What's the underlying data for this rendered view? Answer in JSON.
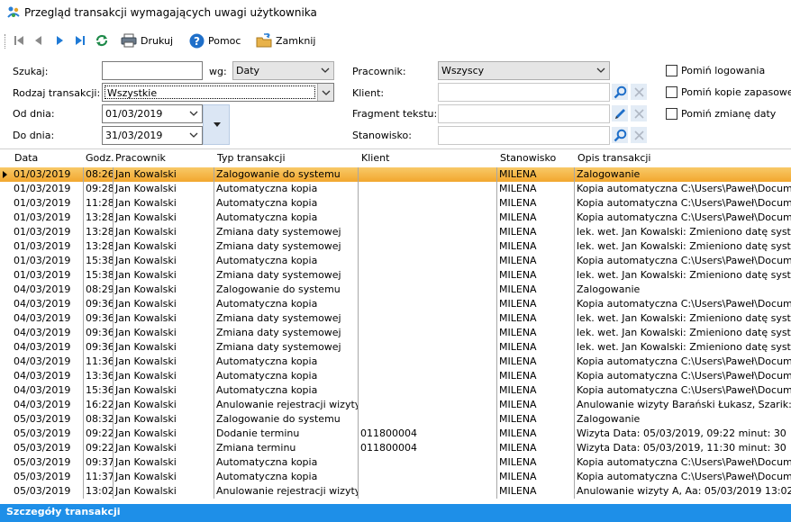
{
  "window": {
    "title": "Przegląd transakcji wymagających uwagi użytkownika"
  },
  "toolbar": {
    "print": "Drukuj",
    "help": "Pomoc",
    "close": "Zamknij"
  },
  "filters": {
    "search_label": "Szukaj:",
    "search_value": "",
    "by_label": "wg:",
    "by_value": "Daty",
    "type_label": "Rodzaj transakcji:",
    "type_value": "Wszystkie",
    "from_label": "Od dnia:",
    "from_value": "01/03/2019",
    "to_label": "Do dnia:",
    "to_value": "31/03/2019",
    "worker_label": "Pracownik:",
    "worker_value": "Wszyscy",
    "client_label": "Klient:",
    "client_value": "",
    "fragment_label": "Fragment tekstu:",
    "fragment_value": "",
    "station_label": "Stanowisko:",
    "station_value": "",
    "skip_logins": "Pomiń logowania",
    "skip_backup": "Pomiń kopie zapasowe",
    "skip_date_change": "Pomiń zmianę daty"
  },
  "grid": {
    "columns": [
      "Data",
      "Godz.",
      "Pracownik",
      "Typ transakcji",
      "Klient",
      "Stanowisko",
      "Opis transakcji"
    ],
    "rows": [
      [
        "01/03/2019",
        "08:26",
        "Jan Kowalski",
        "Zalogowanie do systemu",
        "",
        "MILENA",
        "Zalogowanie"
      ],
      [
        "01/03/2019",
        "09:28",
        "Jan Kowalski",
        "Automatyczna kopia",
        "",
        "MILENA",
        "Kopia automatyczna C:\\Users\\Paweł\\Docum"
      ],
      [
        "01/03/2019",
        "11:28",
        "Jan Kowalski",
        "Automatyczna kopia",
        "",
        "MILENA",
        "Kopia automatyczna C:\\Users\\Paweł\\Docum"
      ],
      [
        "01/03/2019",
        "13:28",
        "Jan Kowalski",
        "Automatyczna kopia",
        "",
        "MILENA",
        "Kopia automatyczna C:\\Users\\Paweł\\Docum"
      ],
      [
        "01/03/2019",
        "13:28",
        "Jan Kowalski",
        "Zmiana daty systemowej",
        "",
        "MILENA",
        "lek. wet. Jan Kowalski: Zmieniono datę syst"
      ],
      [
        "01/03/2019",
        "13:28",
        "Jan Kowalski",
        "Zmiana daty systemowej",
        "",
        "MILENA",
        "lek. wet. Jan Kowalski: Zmieniono datę syst"
      ],
      [
        "01/03/2019",
        "15:38",
        "Jan Kowalski",
        "Automatyczna kopia",
        "",
        "MILENA",
        "Kopia automatyczna C:\\Users\\Paweł\\Docum"
      ],
      [
        "01/03/2019",
        "15:38",
        "Jan Kowalski",
        "Zmiana daty systemowej",
        "",
        "MILENA",
        "lek. wet. Jan Kowalski: Zmieniono datę syst"
      ],
      [
        "04/03/2019",
        "08:29",
        "Jan Kowalski",
        "Zalogowanie do systemu",
        "",
        "MILENA",
        "Zalogowanie"
      ],
      [
        "04/03/2019",
        "09:36",
        "Jan Kowalski",
        "Automatyczna kopia",
        "",
        "MILENA",
        "Kopia automatyczna C:\\Users\\Paweł\\Docum"
      ],
      [
        "04/03/2019",
        "09:36",
        "Jan Kowalski",
        "Zmiana daty systemowej",
        "",
        "MILENA",
        "lek. wet. Jan Kowalski: Zmieniono datę syst"
      ],
      [
        "04/03/2019",
        "09:36",
        "Jan Kowalski",
        "Zmiana daty systemowej",
        "",
        "MILENA",
        "lek. wet. Jan Kowalski: Zmieniono datę syst"
      ],
      [
        "04/03/2019",
        "09:36",
        "Jan Kowalski",
        "Zmiana daty systemowej",
        "",
        "MILENA",
        "lek. wet. Jan Kowalski: Zmieniono datę syst"
      ],
      [
        "04/03/2019",
        "11:36",
        "Jan Kowalski",
        "Automatyczna kopia",
        "",
        "MILENA",
        "Kopia automatyczna C:\\Users\\Paweł\\Docum"
      ],
      [
        "04/03/2019",
        "13:36",
        "Jan Kowalski",
        "Automatyczna kopia",
        "",
        "MILENA",
        "Kopia automatyczna C:\\Users\\Paweł\\Docum"
      ],
      [
        "04/03/2019",
        "15:36",
        "Jan Kowalski",
        "Automatyczna kopia",
        "",
        "MILENA",
        "Kopia automatyczna C:\\Users\\Paweł\\Docum"
      ],
      [
        "04/03/2019",
        "16:22",
        "Jan Kowalski",
        "Anulowanie rejestracji wizyty",
        "",
        "MILENA",
        "Anulowanie wizyty Barański Łukasz, Szarik:"
      ],
      [
        "05/03/2019",
        "08:32",
        "Jan Kowalski",
        "Zalogowanie do systemu",
        "",
        "MILENA",
        "Zalogowanie"
      ],
      [
        "05/03/2019",
        "09:22",
        "Jan Kowalski",
        "Dodanie terminu",
        "011800004",
        "MILENA",
        "Wizyta Data: 05/03/2019, 09:22 minut: 30"
      ],
      [
        "05/03/2019",
        "09:22",
        "Jan Kowalski",
        "Zmiana terminu",
        "011800004",
        "MILENA",
        "Wizyta Data: 05/03/2019, 11:30 minut: 30"
      ],
      [
        "05/03/2019",
        "09:37",
        "Jan Kowalski",
        "Automatyczna kopia",
        "",
        "MILENA",
        "Kopia automatyczna C:\\Users\\Paweł\\Docum"
      ],
      [
        "05/03/2019",
        "11:37",
        "Jan Kowalski",
        "Automatyczna kopia",
        "",
        "MILENA",
        "Kopia automatyczna C:\\Users\\Paweł\\Docum"
      ],
      [
        "05/03/2019",
        "13:02",
        "Jan Kowalski",
        "Anulowanie rejestracji wizyty",
        "",
        "MILENA",
        "Anulowanie wizyty A, Aa: 05/03/2019 13:02"
      ]
    ]
  },
  "statusbar": {
    "label": "Szczegóły transakcji"
  },
  "colors": {
    "accent": "#1e8fe8",
    "selected_row": "#f2a72e"
  }
}
